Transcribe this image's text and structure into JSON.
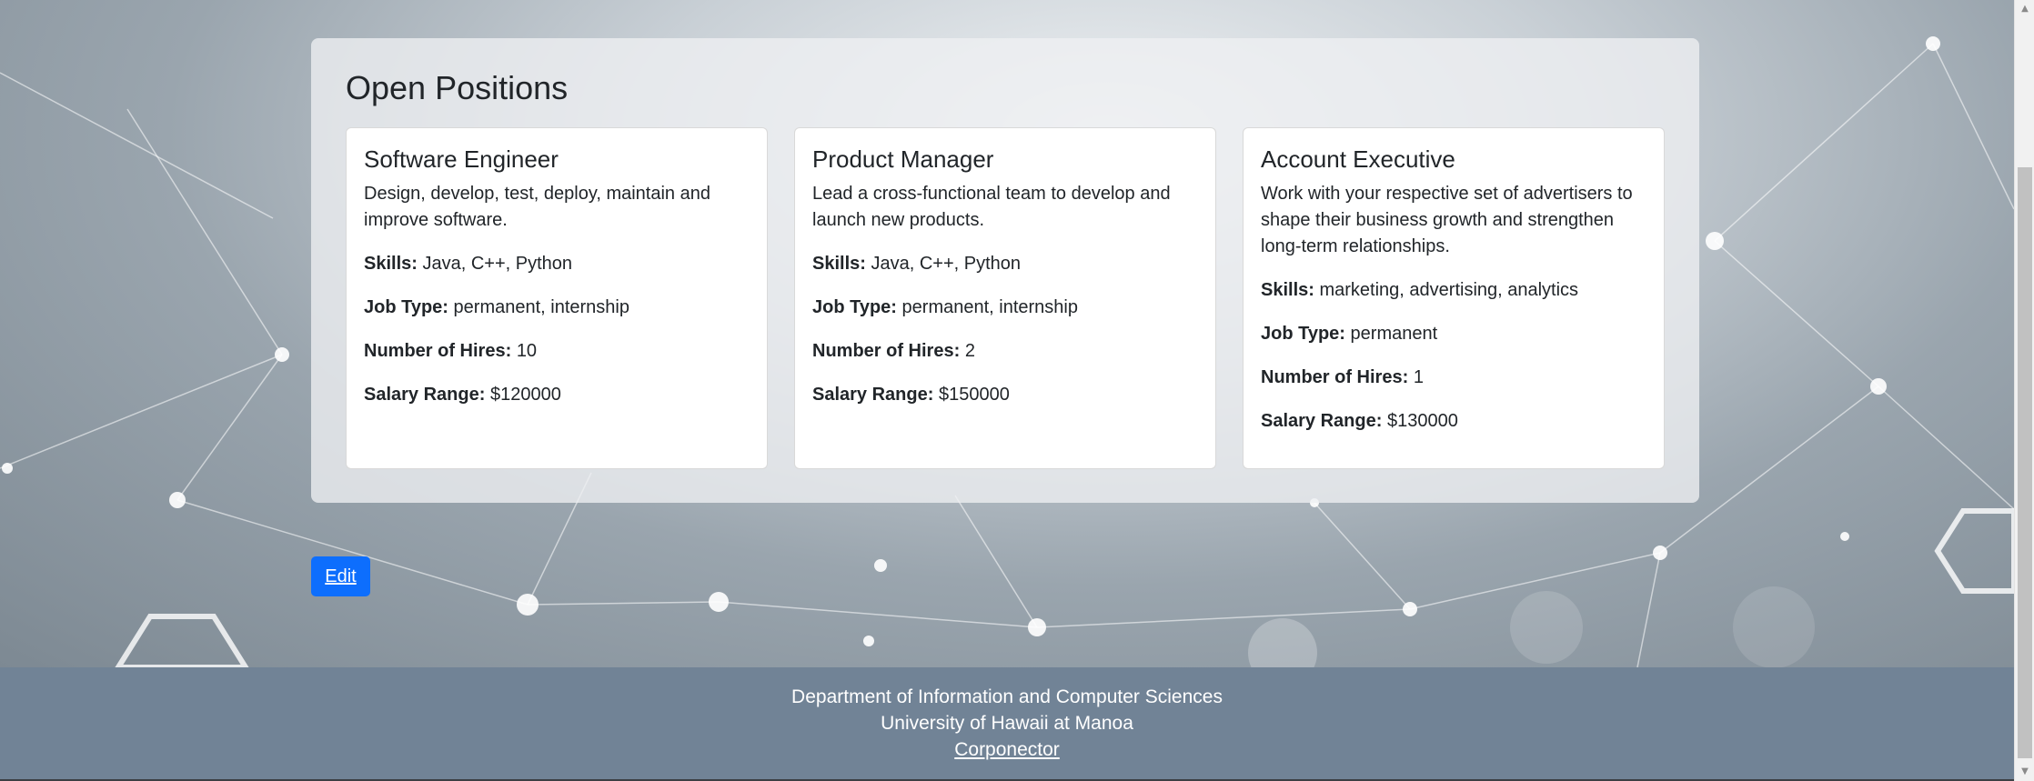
{
  "page": {
    "title": "Open Positions"
  },
  "positions": [
    {
      "title": "Software Engineer",
      "description": "Design, develop, test, deploy, maintain and improve software.",
      "skills_label": "Skills:",
      "skills": "Java, C++, Python",
      "job_type_label": "Job Type:",
      "job_type": "permanent, internship",
      "hires_label": "Number of Hires:",
      "hires": "10",
      "salary_label": "Salary Range:",
      "salary": "$120000"
    },
    {
      "title": "Product Manager",
      "description": "Lead a cross-functional team to develop and launch new products.",
      "skills_label": "Skills:",
      "skills": "Java, C++, Python",
      "job_type_label": "Job Type:",
      "job_type": "permanent, internship",
      "hires_label": "Number of Hires:",
      "hires": "2",
      "salary_label": "Salary Range:",
      "salary": "$150000"
    },
    {
      "title": "Account Executive",
      "description": "Work with your respective set of advertisers to shape their business growth and strengthen long-term relationships.",
      "skills_label": "Skills:",
      "skills": "marketing, advertising, analytics",
      "job_type_label": "Job Type:",
      "job_type": "permanent",
      "hires_label": "Number of Hires:",
      "hires": "1",
      "salary_label": "Salary Range:",
      "salary": "$130000"
    }
  ],
  "actions": {
    "edit_label": "Edit"
  },
  "footer": {
    "department": "Department of Information and Computer Sciences",
    "university": "University of Hawaii at Manoa",
    "link_label": "Corponector"
  },
  "colors": {
    "primary": "#0d6efd",
    "footer_bg": "#718396",
    "card_bg": "#ffffff"
  }
}
